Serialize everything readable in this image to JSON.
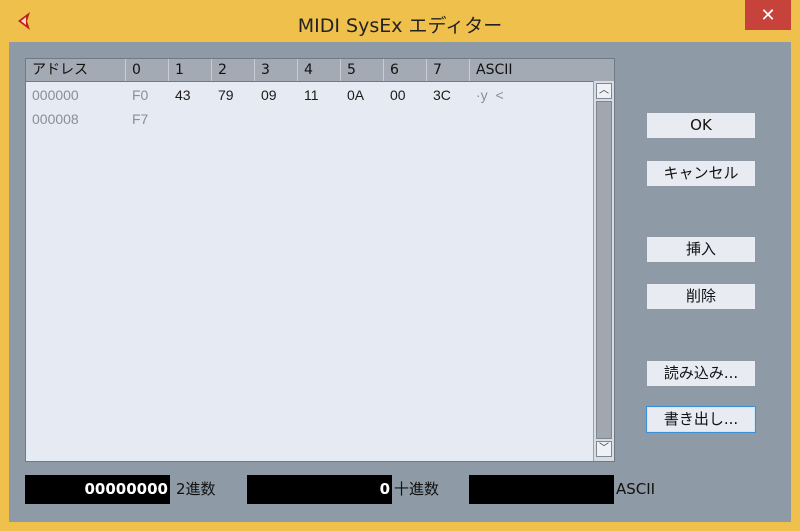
{
  "window": {
    "title": "MIDI SysEx エディター",
    "close_glyph": "✕",
    "accent": "#f0c04c",
    "close_color": "#c7423a"
  },
  "table": {
    "columns": [
      "アドレス",
      "0",
      "1",
      "2",
      "3",
      "4",
      "5",
      "6",
      "7",
      "ASCII"
    ],
    "rows": [
      {
        "address": "000000",
        "bytes": [
          "F0",
          "43",
          "79",
          "09",
          "11",
          "0A",
          "00",
          "3C"
        ],
        "ascii": "·y  <"
      },
      {
        "address": "000008",
        "bytes": [
          "F7",
          "",
          "",
          "",
          "",
          "",
          "",
          ""
        ],
        "ascii": ""
      }
    ]
  },
  "scrollbar": {
    "up_glyph": "︿",
    "down_glyph": "﹀"
  },
  "buttons": {
    "ok": "OK",
    "cancel": "キャンセル",
    "insert": "挿入",
    "delete": "削除",
    "load": "読み込み...",
    "export": "書き出し..."
  },
  "fields": {
    "binary_value": "00000000",
    "binary_label": "2進数",
    "decimal_value": "0",
    "decimal_label": "十進数",
    "ascii_value": "",
    "ascii_label": "ASCII"
  }
}
